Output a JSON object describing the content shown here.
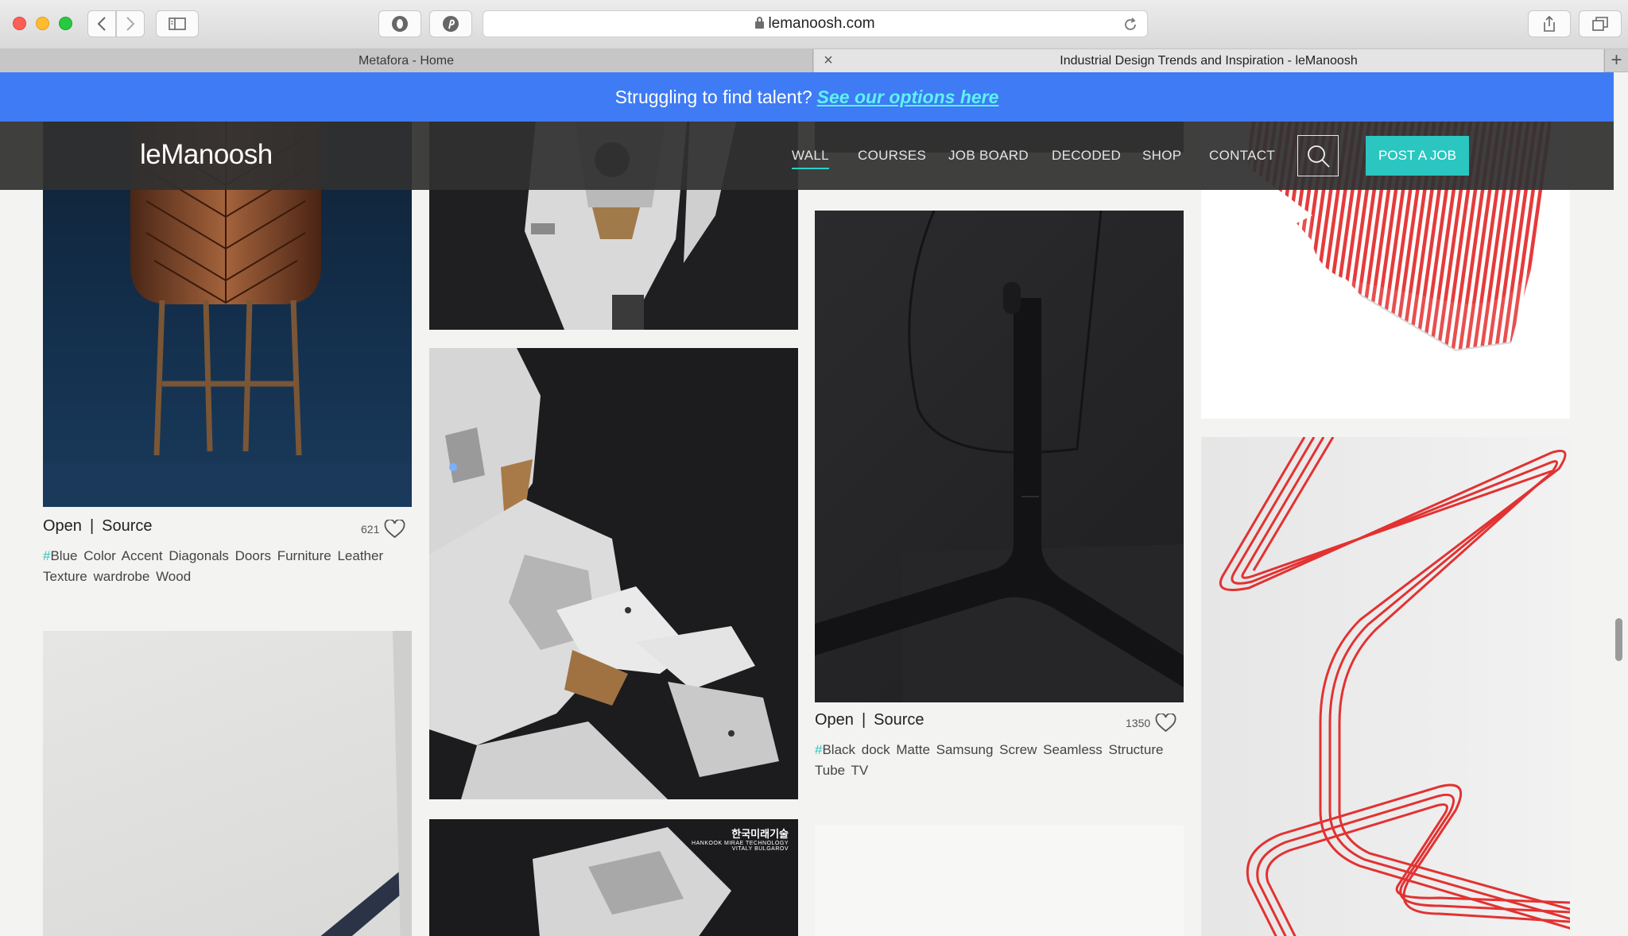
{
  "browser": {
    "url": "lemanoosh.com",
    "tabs": [
      {
        "title": "Metafora - Home"
      },
      {
        "title": "Industrial Design Trends and Inspiration - leManoosh"
      }
    ]
  },
  "banner": {
    "text": "Struggling to find talent?",
    "link": "See our options here"
  },
  "nav": {
    "logo": "leManoosh",
    "items": [
      "WALL",
      "COURSES",
      "JOB BOARD",
      "DECODED",
      "SHOP",
      "CONTACT"
    ],
    "active": "WALL",
    "cta": "POST A JOB"
  },
  "cards": [
    {
      "open": "Open",
      "source": "Source",
      "likes": "621",
      "hash": "#",
      "tags": "Blue Color Accent Diagonals Doors Furniture Leather Texture wardrobe Wood"
    },
    {
      "open": "Open",
      "source": "Source",
      "likes": "1350",
      "hash": "#",
      "tags": "Black dock Matte Samsung Screw Seamless Structure Tube TV"
    }
  ],
  "watermark": {
    "line1": "한국미래기술",
    "line2": "HANKOOK MIRAE TECHNOLOGY",
    "line3": "VITALY BULGAROV"
  },
  "colors": {
    "banner": "#3e7bf5",
    "accent": "#2bc6c0",
    "navbar": "#303030"
  }
}
